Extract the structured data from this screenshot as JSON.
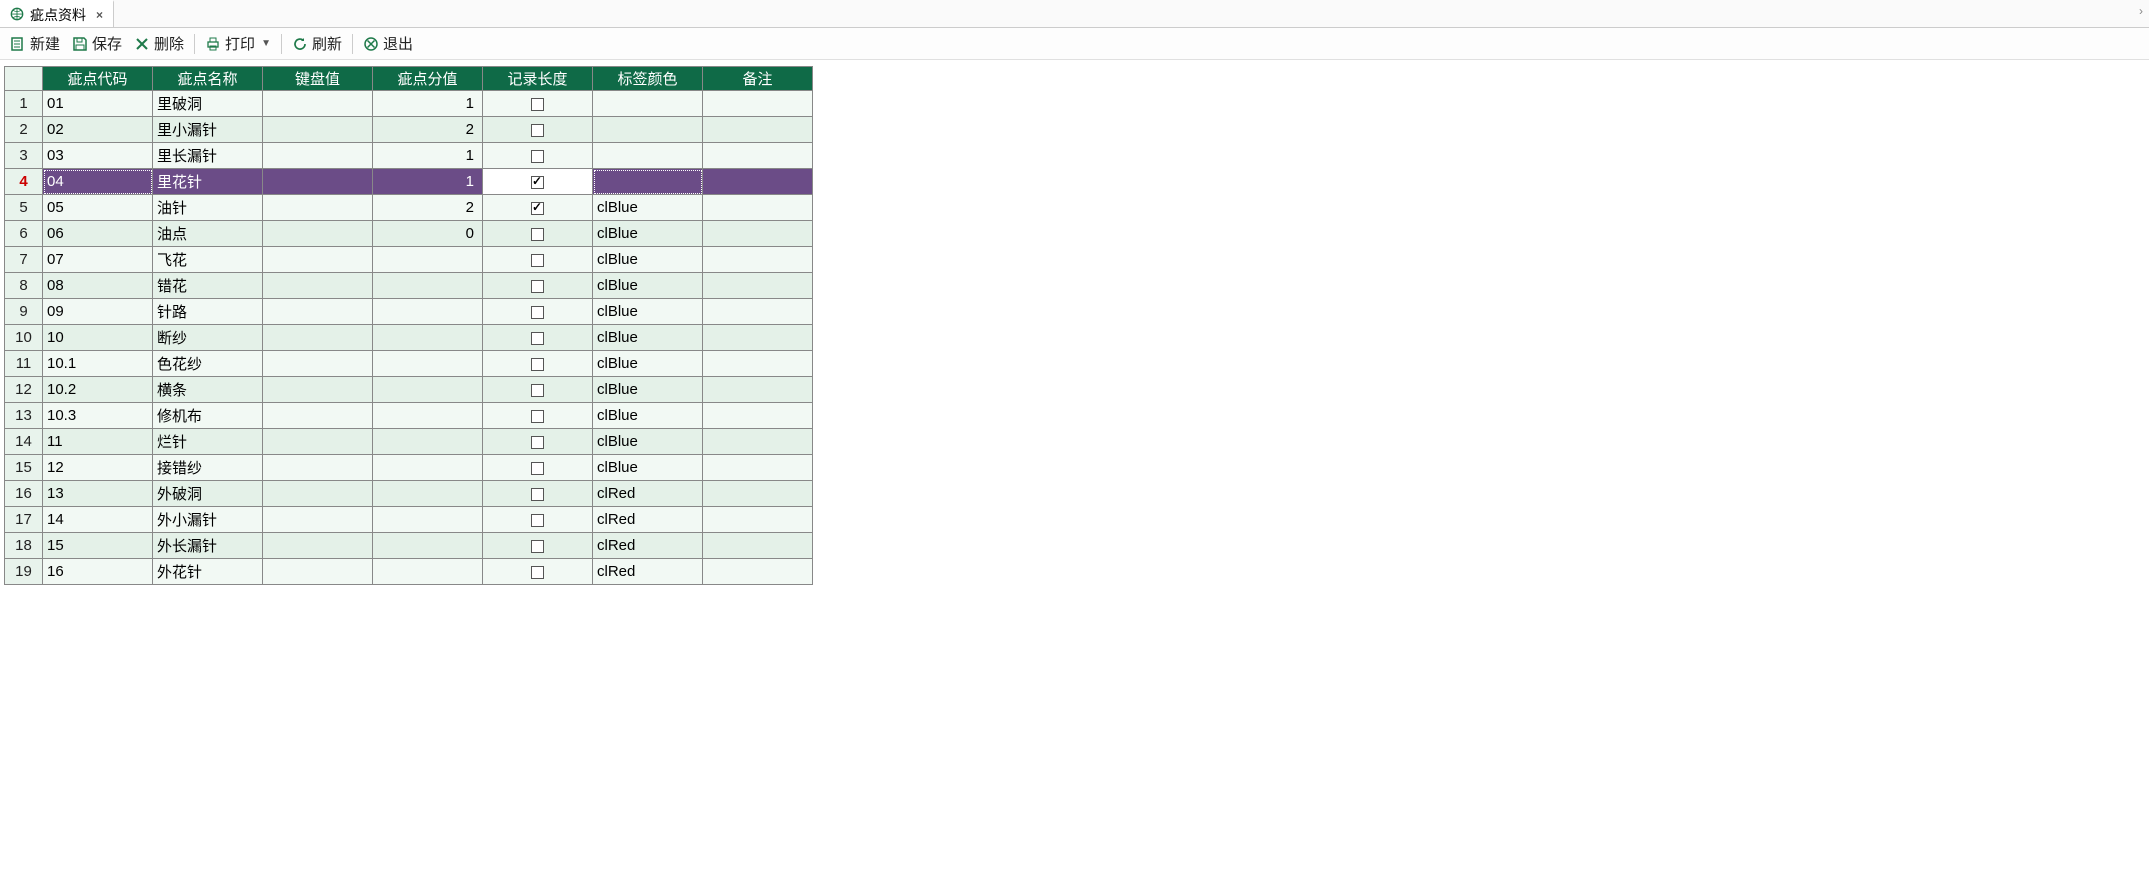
{
  "tab": {
    "title": "疵点资料"
  },
  "toolbar": {
    "new_label": "新建",
    "save_label": "保存",
    "delete_label": "删除",
    "print_label": "打印",
    "refresh_label": "刷新",
    "exit_label": "退出"
  },
  "columns": {
    "code": "疵点代码",
    "name": "疵点名称",
    "key": "键盘值",
    "score": "疵点分值",
    "reclen": "记录长度",
    "label_color": "标签颜色",
    "remark": "备注"
  },
  "selected_index": 3,
  "rows": [
    {
      "code": "01",
      "name": "里破洞",
      "key": "",
      "score": "1",
      "reclen": false,
      "label_color": "",
      "remark": ""
    },
    {
      "code": "02",
      "name": "里小漏针",
      "key": "",
      "score": "2",
      "reclen": false,
      "label_color": "",
      "remark": ""
    },
    {
      "code": "03",
      "name": "里长漏针",
      "key": "",
      "score": "1",
      "reclen": false,
      "label_color": "",
      "remark": ""
    },
    {
      "code": "04",
      "name": "里花针",
      "key": "",
      "score": "1",
      "reclen": true,
      "label_color": "",
      "remark": ""
    },
    {
      "code": "05",
      "name": "油针",
      "key": "",
      "score": "2",
      "reclen": true,
      "label_color": "clBlue",
      "remark": ""
    },
    {
      "code": "06",
      "name": "油点",
      "key": "",
      "score": "0",
      "reclen": false,
      "label_color": "clBlue",
      "remark": ""
    },
    {
      "code": "07",
      "name": "飞花",
      "key": "",
      "score": "",
      "reclen": false,
      "label_color": "clBlue",
      "remark": ""
    },
    {
      "code": "08",
      "name": "错花",
      "key": "",
      "score": "",
      "reclen": false,
      "label_color": "clBlue",
      "remark": ""
    },
    {
      "code": "09",
      "name": "针路",
      "key": "",
      "score": "",
      "reclen": false,
      "label_color": "clBlue",
      "remark": ""
    },
    {
      "code": "10",
      "name": "断纱",
      "key": "",
      "score": "",
      "reclen": false,
      "label_color": "clBlue",
      "remark": ""
    },
    {
      "code": "10.1",
      "name": "色花纱",
      "key": "",
      "score": "",
      "reclen": false,
      "label_color": "clBlue",
      "remark": ""
    },
    {
      "code": "10.2",
      "name": "横条",
      "key": "",
      "score": "",
      "reclen": false,
      "label_color": "clBlue",
      "remark": ""
    },
    {
      "code": "10.3",
      "name": "修机布",
      "key": "",
      "score": "",
      "reclen": false,
      "label_color": "clBlue",
      "remark": ""
    },
    {
      "code": "11",
      "name": "烂针",
      "key": "",
      "score": "",
      "reclen": false,
      "label_color": "clBlue",
      "remark": ""
    },
    {
      "code": "12",
      "name": "接错纱",
      "key": "",
      "score": "",
      "reclen": false,
      "label_color": "clBlue",
      "remark": ""
    },
    {
      "code": "13",
      "name": "外破洞",
      "key": "",
      "score": "",
      "reclen": false,
      "label_color": "clRed",
      "remark": ""
    },
    {
      "code": "14",
      "name": "外小漏针",
      "key": "",
      "score": "",
      "reclen": false,
      "label_color": "clRed",
      "remark": ""
    },
    {
      "code": "15",
      "name": "外长漏针",
      "key": "",
      "score": "",
      "reclen": false,
      "label_color": "clRed",
      "remark": ""
    },
    {
      "code": "16",
      "name": "外花针",
      "key": "",
      "score": "",
      "reclen": false,
      "label_color": "clRed",
      "remark": ""
    }
  ]
}
